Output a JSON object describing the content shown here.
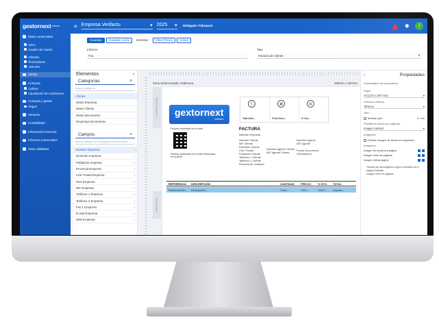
{
  "app": {
    "logo": "gextornext",
    "logo_sub": "software",
    "company": "Empresa Verifactu",
    "year": "2025",
    "obligation": "Obligado Tributario",
    "avatar_letter": "J"
  },
  "sidebar": {
    "items": [
      {
        "label": "Datos comerciales"
      },
      {
        "label": "Inicio"
      },
      {
        "label": "Cuadro de mando"
      },
      {
        "label": "Clientes"
      },
      {
        "label": "Proveedores"
      },
      {
        "label": "Artículos"
      },
      {
        "label": "Ventas"
      },
      {
        "label": "Compras"
      },
      {
        "label": "Cobros"
      },
      {
        "label": "Liquidación de comisiones"
      },
      {
        "label": "Compras y gastos"
      },
      {
        "label": "Pagos"
      },
      {
        "label": "Almacén"
      },
      {
        "label": "Contabilidad"
      },
      {
        "label": "Información tesorería"
      },
      {
        "label": "Informes Comerciales"
      },
      {
        "label": "Otras utilidades"
      }
    ]
  },
  "toolbar": {
    "save": "Guardar",
    "save_as": "Guardar como",
    "delete": "Eliminar",
    "preview": "Vista Previa",
    "back": "Volver",
    "doc_label": "Informe",
    "doc_value": "Fra.",
    "type_label": "Tipo",
    "type_value": "Factura de cliente"
  },
  "elements": {
    "title": "Elementos",
    "categories_title": "Categorías",
    "categories_search": "Buscar categoría",
    "categories": [
      "Cliente",
      "Datos Empresa",
      "Datos Cliente",
      "Datos Documento",
      "Empresas Documento"
    ],
    "fields_title": "Campos",
    "fields_search": "Buscar campos en la categoría seleccionada",
    "fields": [
      "Nombre Empresa",
      "Domicilio empresa",
      "Población empresa",
      "Provincia Empresa",
      "Cód. Postal Empresa",
      "País Empresa",
      "NIF Empresa",
      "Teléfono 1 Empresa",
      "Teléfono 2 Empresa",
      "Fax 1 Empresa",
      "E-mail Empresa",
      "Web Empresa"
    ]
  },
  "canvas": {
    "zone": "Zona Seleccionada: Cabecera",
    "zoom": "200mm x 297mm",
    "vtab_header": "Zona Cabecera",
    "vtab_lines": "Zona Líneas",
    "brand": "gextornext",
    "brand_sub": "software",
    "info_cols": [
      "Total Docu...",
      "Fecha Docu...",
      "Nº Doc..."
    ],
    "qr_caption": "Factura verificable en la sede",
    "qr_note": "Factura verificable en la sede electrónica de la AEAT",
    "factura": "FACTURA",
    "left_lines": [
      "Nombre Empresa",
      "Nombre Cliente",
      "NIF Cliente",
      "Domicilio Cliente",
      "Cód. Postal",
      "Población Cliente",
      "Teléfono 1 Cliente",
      "Teléfono 1 Cliente",
      "Persona de contacto"
    ],
    "mid_lines": [
      "Nombre Agente Cliente",
      "NIF Agente Cliente"
    ],
    "right_lines": [
      "Nombre Agente",
      "NIF Agente",
      "Fecha Documento",
      "Vencimiento"
    ],
    "table_headers": [
      "REFERENCIA",
      "DESCRIPCIÓN",
      "CANTIDAD",
      "PRECIO",
      "% DTO.",
      "TOTAL"
    ],
    "table_row": [
      "Referencia lin...",
      "Descripción ...",
      "Canti...",
      "Preci...",
      "%Dto...",
      "Importe..."
    ]
  },
  "props": {
    "title": "Propiedades",
    "section": "Propiedades del documento",
    "paper_label": "Papel",
    "paper_value": "A4 (210 x 297 mm)",
    "font_label": "Letra por defecto",
    "font_value": "Tahoma",
    "size_label": "Tam.",
    "margin_check": "Mostrar grid",
    "margin_value": "5",
    "margin_unit": "mm",
    "tpl_label": "Plantilla de fondo por páginas",
    "tpl_value": "Imagen Vertical",
    "images_label": "Imágenes",
    "images_check": "Ocultar imagen de fondo en impresión",
    "images_title": "Imágenes",
    "image_rows": [
      "Imagen de la primera página",
      "Imagen resto de páginas",
      "Imagen última página"
    ],
    "bullets": [
      "Tamaño de las imágenes según el tamaño de la página indicado.",
      "Imagen resto de páginas."
    ]
  }
}
